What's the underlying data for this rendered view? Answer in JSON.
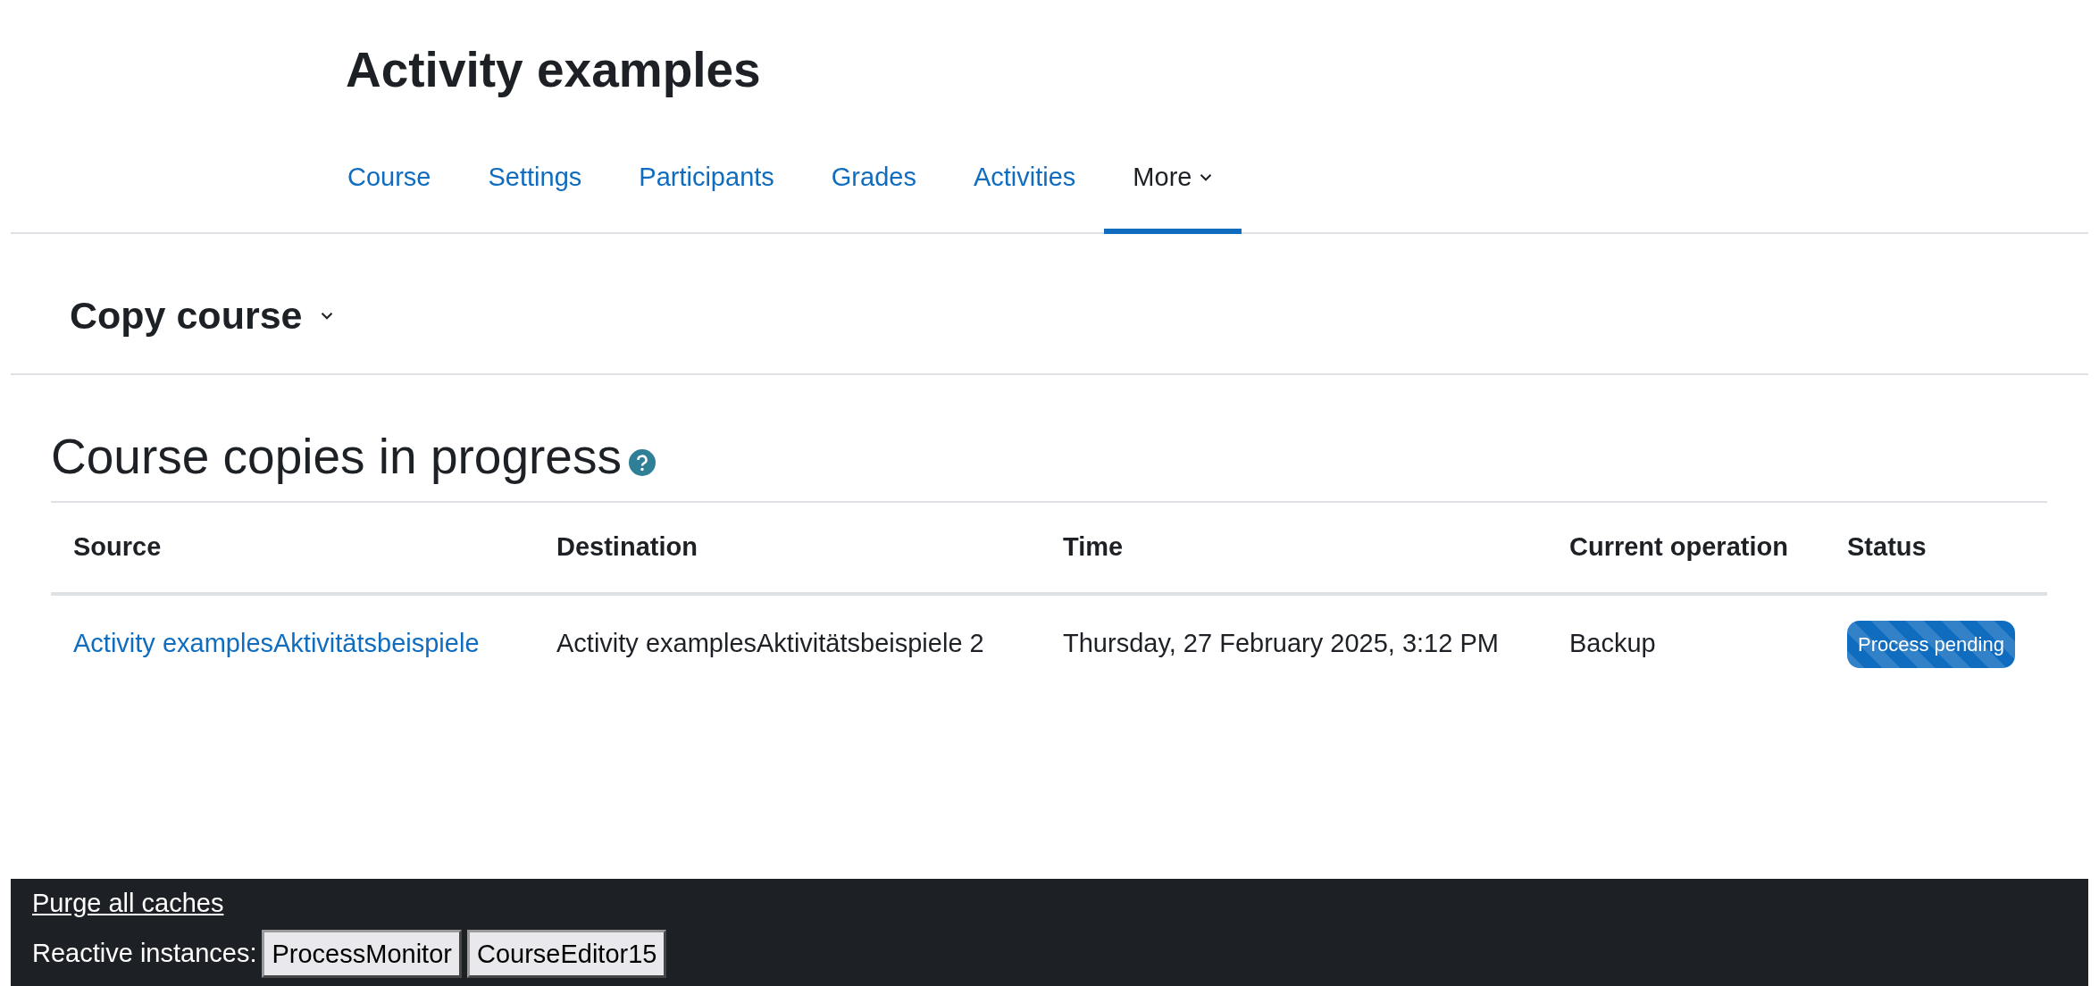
{
  "page_title": "Activity examples",
  "tabs": [
    {
      "label": "Course",
      "selected": false,
      "kind": "link"
    },
    {
      "label": "Settings",
      "selected": false,
      "kind": "link"
    },
    {
      "label": "Participants",
      "selected": false,
      "kind": "link"
    },
    {
      "label": "Grades",
      "selected": false,
      "kind": "link"
    },
    {
      "label": "Activities",
      "selected": false,
      "kind": "link"
    },
    {
      "label": "More",
      "selected": true,
      "kind": "dropdown"
    }
  ],
  "action_menu": {
    "label": "Copy course"
  },
  "section": {
    "heading": "Course copies in progress"
  },
  "table": {
    "columns": [
      "Source",
      "Destination",
      "Time",
      "Current operation",
      "Status"
    ],
    "rows": [
      {
        "source": "Activity examplesAktivitätsbeispiele",
        "destination": "Activity examplesAktivitätsbeispiele 2",
        "time": "Thursday, 27 February 2025, 3:12 PM",
        "operation": "Backup",
        "status": "Process pending"
      }
    ]
  },
  "footer": {
    "link": "Purge all caches",
    "label": "Reactive instances:",
    "buttons": [
      "ProcessMonitor",
      "CourseEditor15"
    ]
  }
}
